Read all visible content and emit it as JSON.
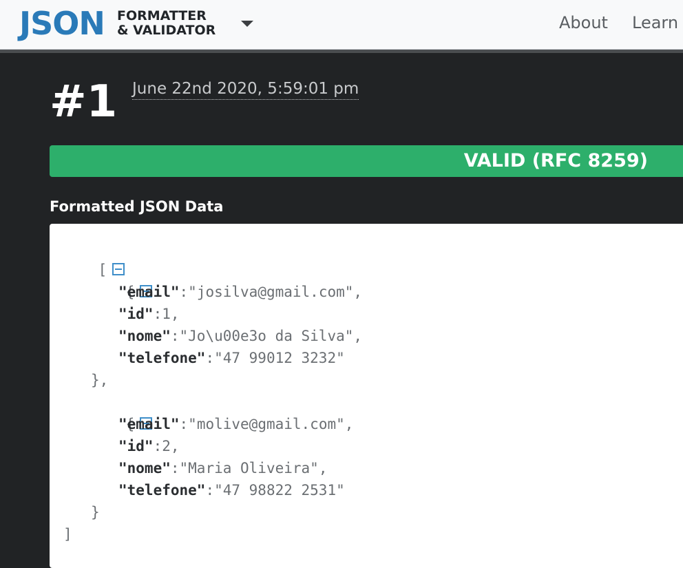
{
  "nav": {
    "logo_main": "JSON",
    "logo_line1": "FORMATTER",
    "logo_line2": "& VALIDATOR",
    "links": [
      "About",
      "Learn"
    ]
  },
  "result": {
    "number": "#1",
    "timestamp": "June 22nd 2020, 5:59:01 pm",
    "status": "VALID (RFC 8259)",
    "status_color": "#2daf6b"
  },
  "formatted": {
    "title": "Formatted JSON Data",
    "open_bracket": "[",
    "close_bracket": "]",
    "records": [
      {
        "open": "{",
        "close": "},",
        "fields": [
          {
            "key": "\"email\"",
            "sep": ":",
            "value": "\"josilva@gmail.com\"",
            "comma": ","
          },
          {
            "key": "\"id\"",
            "sep": ":",
            "value": "1",
            "comma": ","
          },
          {
            "key": "\"nome\"",
            "sep": ":",
            "value": "\"Jo\\u00e3o da Silva\"",
            "comma": ","
          },
          {
            "key": "\"telefone\"",
            "sep": ":",
            "value": "\"47 99012 3232\"",
            "comma": ""
          }
        ]
      },
      {
        "open": "{",
        "close": "}",
        "fields": [
          {
            "key": "\"email\"",
            "sep": ":",
            "value": "\"molive@gmail.com\"",
            "comma": ","
          },
          {
            "key": "\"id\"",
            "sep": ":",
            "value": "2",
            "comma": ","
          },
          {
            "key": "\"nome\"",
            "sep": ":",
            "value": "\"Maria Oliveira\"",
            "comma": ","
          },
          {
            "key": "\"telefone\"",
            "sep": ":",
            "value": "\"47 98822 2531\"",
            "comma": ""
          }
        ]
      }
    ]
  },
  "colors": {
    "accent": "#2a7ab8",
    "background": "#212325",
    "collapse_icon": "#3e8ec9"
  }
}
